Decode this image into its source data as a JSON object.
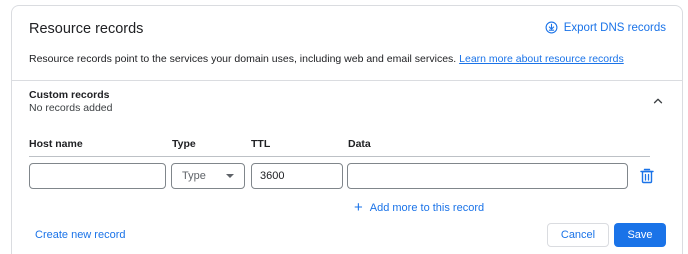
{
  "header": {
    "title": "Resource records",
    "export_label": "Export DNS records",
    "export_icon": "download-circle-icon"
  },
  "description": {
    "text": "Resource records point to the services your domain uses, including web and email services.",
    "link_label": "Learn more about resource records"
  },
  "custom_records": {
    "title": "Custom records",
    "status": "No records added",
    "collapse_icon": "chevron-up-icon"
  },
  "table": {
    "columns": [
      "Host name",
      "Type",
      "TTL",
      "Data"
    ],
    "row": {
      "host_name": "",
      "type_placeholder": "Type",
      "ttl": "3600",
      "data": "",
      "delete_icon": "trash-icon"
    }
  },
  "actions": {
    "add_more_label": "Add more to this record",
    "create_new_label": "Create new record",
    "cancel_label": "Cancel",
    "save_label": "Save"
  },
  "colors": {
    "accent": "#1a73e8",
    "border": "#dadce0",
    "text": "#202124"
  }
}
